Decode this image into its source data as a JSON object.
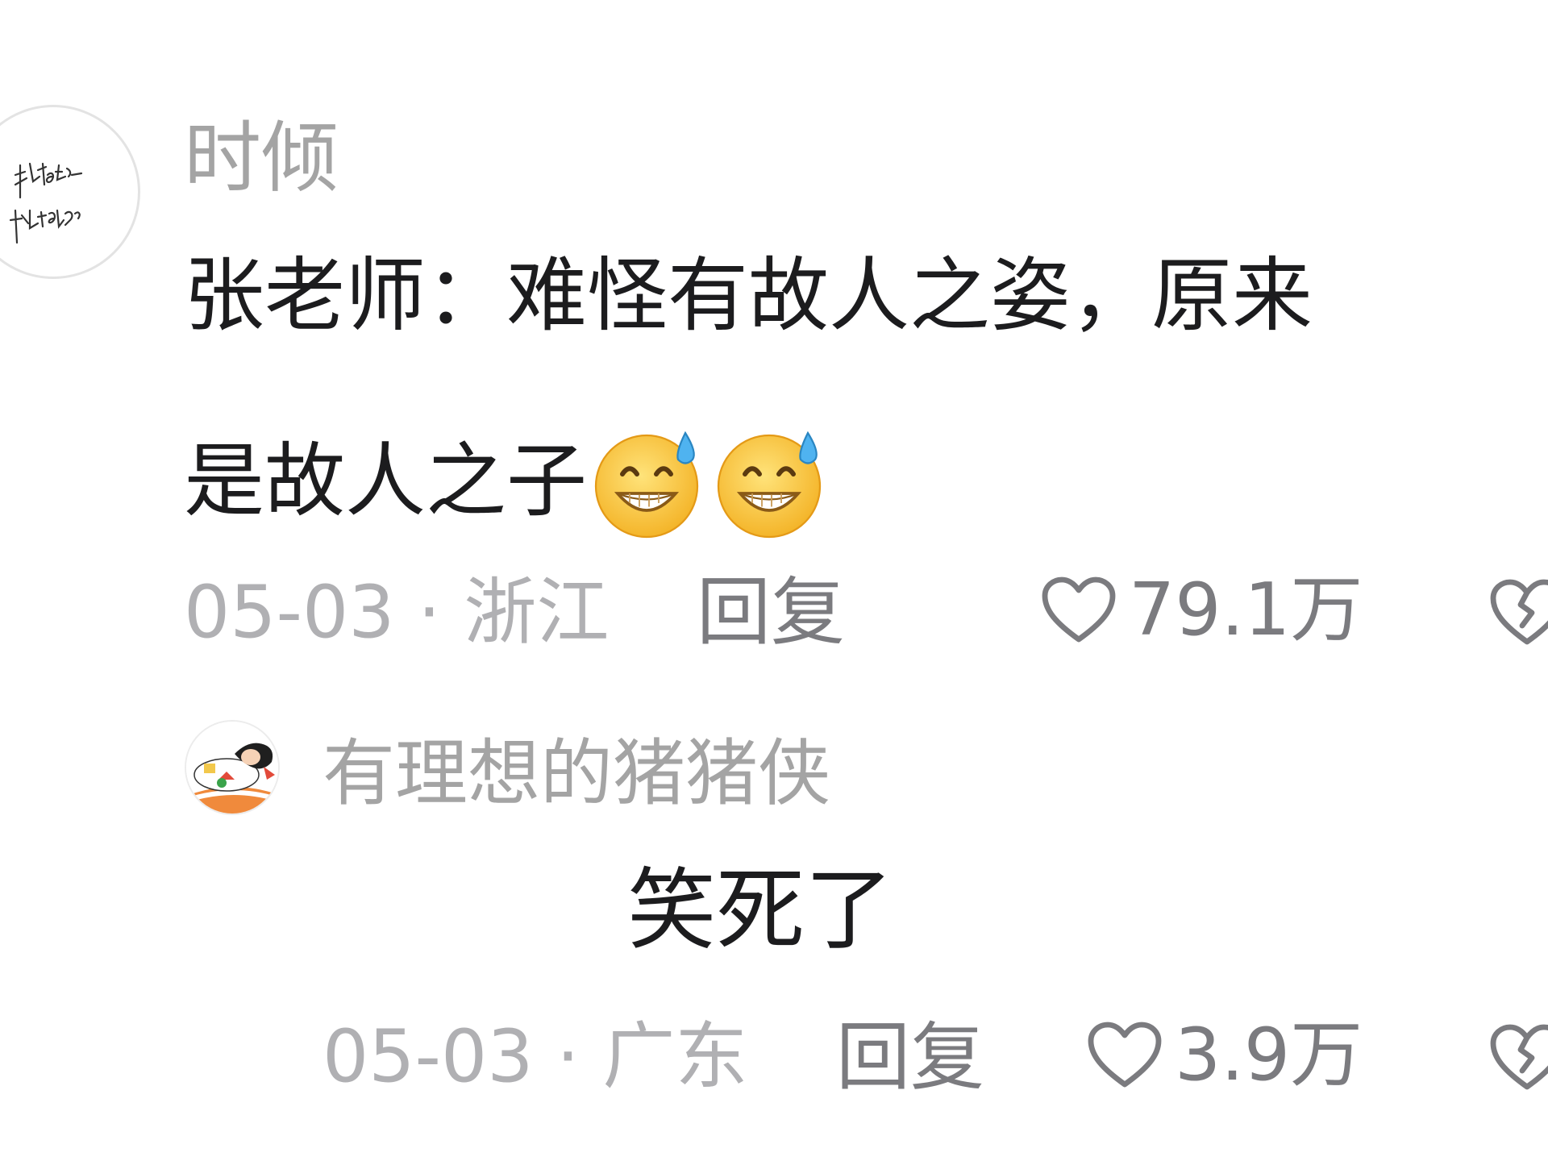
{
  "comment": {
    "avatar_icon": "handwritten-avatar-icon",
    "username": "时倾",
    "text_line1": "张老师：难怪有故人之姿，原来",
    "text_line2": "是故人之子",
    "emojis": [
      "grin-sweat-emoji",
      "grin-sweat-emoji"
    ],
    "date_location": "05-03 · 浙江",
    "reply_label": "回复",
    "like_count": "79.1万"
  },
  "reply": {
    "avatar_icon": "cartoon-avatar-icon",
    "username": "有理想的猪猪侠",
    "text": "笑死了",
    "date_location": "05-03 · 广东",
    "reply_label": "回复",
    "like_count": "3.9万"
  },
  "colors": {
    "username": "#a4a4a4",
    "text": "#1c1c1e",
    "meta": "#b0b0b3",
    "action": "#7b7b7f"
  }
}
